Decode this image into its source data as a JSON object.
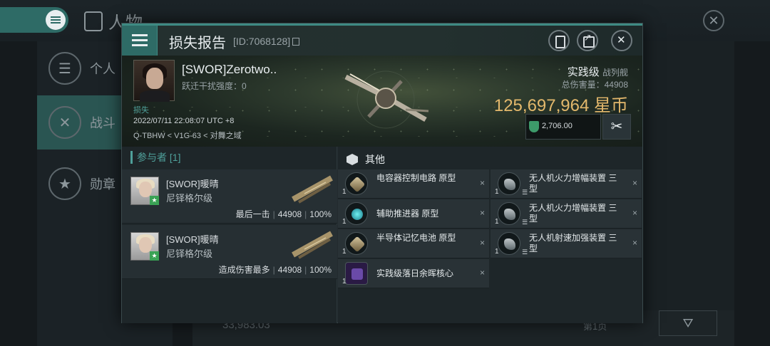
{
  "background": {
    "title": "人物",
    "sidebar": [
      {
        "label": "个人",
        "icon": "menu-icon"
      },
      {
        "label": "战斗",
        "icon": "crossed-swords-icon"
      },
      {
        "label": "勋章",
        "icon": "star-badge-icon"
      }
    ],
    "bottom_amount": "33,983.03",
    "page_label": "第1页"
  },
  "modal": {
    "title": "损失报告",
    "report_id": "[ID:7068128]",
    "victim": {
      "name": "[SWOR]Zerotwo..",
      "warp_scramble": "跃迁干扰强度：0",
      "loss_tag": "损失",
      "datetime": "2022/07/11 22:08:07 UTC +8",
      "location": "Q-TBHW < V1G-63 < 对舞之域",
      "ship_class": "实践级",
      "ship_type": "战列舰",
      "total_damage": "总伤害量：44908",
      "isk_value": "125,697,964 星币",
      "ledger_value": "2,706.00"
    },
    "participants_header": "参与者 [1]",
    "participants": [
      {
        "name": "[SWOR]暖晴",
        "ship": "尼铎格尔级",
        "note": "最后一击",
        "damage": "44908",
        "percent": "100%"
      },
      {
        "name": "[SWOR]暖晴",
        "ship": "尼铎格尔级",
        "note": "造成伤害最多",
        "damage": "44908",
        "percent": "100%"
      }
    ],
    "items_header": "其他",
    "items_left": [
      {
        "name": "电容器控制电路 原型",
        "qty": "1",
        "icon": "capacitor-circuit-icon"
      },
      {
        "name": "辅助推进器 原型",
        "qty": "1",
        "icon": "thruster-icon"
      },
      {
        "name": "半导体记忆电池 原型",
        "qty": "1",
        "icon": "memory-cell-icon"
      },
      {
        "name": "实践级落日余晖核心",
        "qty": "1",
        "icon": "core-icon"
      }
    ],
    "items_right": [
      {
        "name": "无人机火力增幅装置 三型",
        "qty": "1",
        "icon": "drone-damage-icon"
      },
      {
        "name": "无人机火力增幅装置 三型",
        "qty": "1",
        "icon": "drone-damage-icon"
      },
      {
        "name": "无人机射速加强装置 三型",
        "qty": "1",
        "icon": "drone-rof-icon"
      }
    ],
    "remove_glyph": "×"
  }
}
